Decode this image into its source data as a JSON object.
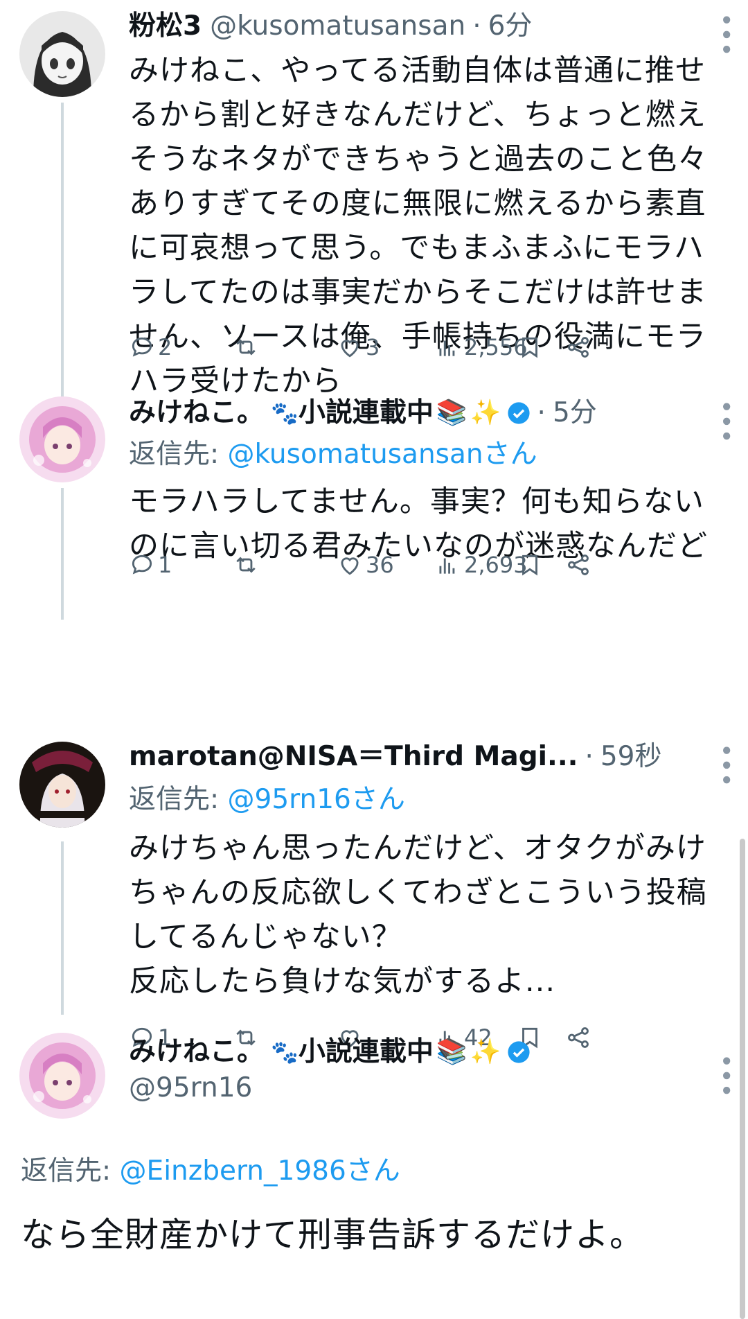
{
  "posts": [
    {
      "name": "粉松3",
      "handle": "@kusomatusansan",
      "time": "6分",
      "text": "みけねこ、やってる活動自体は普通に推せるから割と好きなんだけど、ちょっと燃えそうなネタができちゃうと過去のこと色々ありすぎてその度に無限に燃えるから素直に可哀想って思う。でもまふまふにモラハラしてたのは事実だからそこだけは許せません、ソースは俺、手帳持ちの役満にモラハラ受けたから",
      "replies": "2",
      "likes": "3",
      "views": "2,556"
    },
    {
      "name": "みけねこ。",
      "name_suffix": "小説連載中",
      "time": "5分",
      "reply_label": "返信先: ",
      "reply_to": "@kusomatusansanさん",
      "text": "モラハラしてません。事実？何も知らないのに言い切る君みたいなのが迷惑なんだど",
      "replies": "1",
      "likes": "36",
      "views": "2,693"
    },
    {
      "name": "marotan@NISA＝Third Magi...",
      "time": "59秒",
      "reply_label": "返信先: ",
      "reply_to": "@95rn16さん",
      "text": "みけちゃん思ったんだけど、オタクがみけちゃんの反応欲しくてわざとこういう投稿してるんじゃない？\n反応したら負けな気がするよ...",
      "replies": "1",
      "likes": "",
      "views": "42"
    },
    {
      "name": "みけねこ。",
      "name_suffix": "小説連載中",
      "handle": "@95rn16",
      "reply_label": "返信先: ",
      "reply_to": "@Einzbern_1986さん",
      "text": "なら全財産かけて刑事告訴するだけよ。"
    }
  ],
  "colors": {
    "accent": "#1d9bf0",
    "muted": "#536471",
    "text": "#0f1419"
  }
}
